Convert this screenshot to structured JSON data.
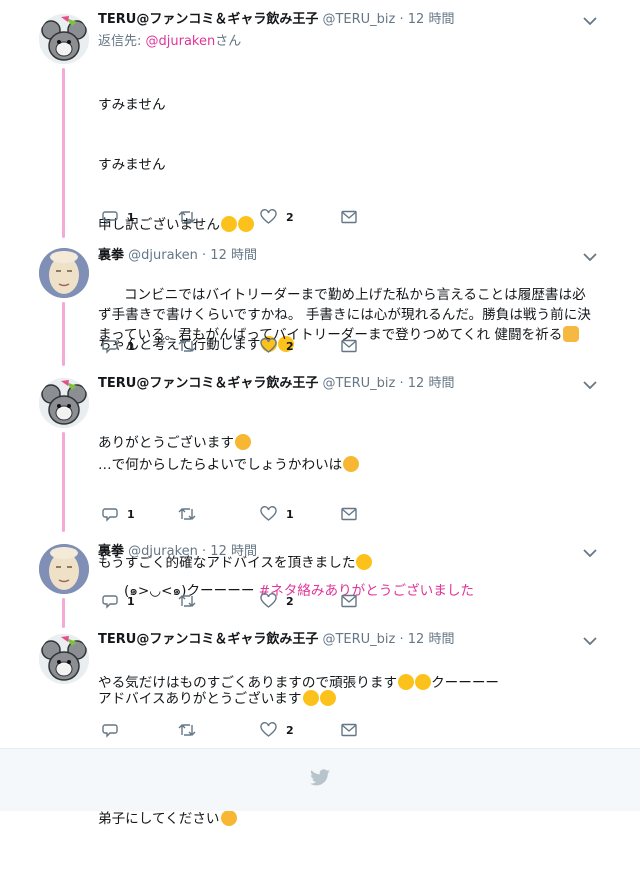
{
  "tweets": [
    {
      "name": "TERU@ファンコミ＆ギャラ飲み王子",
      "handle": "@TERU_biz",
      "dot": "·",
      "time": "12 時間",
      "reply_prefix": "返信先: ",
      "reply_mention": "@djuraken",
      "reply_suffix": "さん",
      "lines": [
        "すみません",
        "すみません",
        "申し訳ございません",
        "",
        "ちゃんと考えて行動します",
        "",
        "…で何からしたらよいでしょうかわいは"
      ],
      "reply_count": "1",
      "retweet_count": "",
      "like_count": "2"
    },
    {
      "name": "裏拳",
      "handle": "@djuraken",
      "dot": "·",
      "time": "12 時間",
      "text": "コンビニではバイトリーダーまで勤め上げた私から言えることは履歴書は必ず手書きで書けくらいですかね。 手書きには心が現れるんだ。勝負は戦う前に決まっている。君もがんばってバイトリーダーまで登りつめてくれ 健闘を祈る",
      "reply_count": "1",
      "retweet_count": "",
      "like_count": "2"
    },
    {
      "name": "TERU@ファンコミ＆ギャラ飲み王子",
      "handle": "@TERU_biz",
      "dot": "·",
      "time": "12 時間",
      "lines": [
        "ありがとうございます",
        "",
        "もうすごく的確なアドバイスを頂きました",
        "",
        "やる気だけはものすごくありますので頑張ります"
      ],
      "line5_tail": "クーーーー",
      "reply_count": "1",
      "retweet_count": "",
      "like_count": "1"
    },
    {
      "name": "裏拳",
      "handle": "@djuraken",
      "dot": "·",
      "time": "12 時間",
      "text_plain": "(๑>◡<๑)クーーーー ",
      "hashtag": "#ネタ絡みありがとうございました",
      "reply_count": "1",
      "retweet_count": "",
      "like_count": "2"
    },
    {
      "name": "TERU@ファンコミ＆ギャラ飲み王子",
      "handle": "@TERU_biz",
      "dot": "·",
      "time": "12 時間",
      "lines": [
        "アドバイスありがとうございます",
        "",
        "弟子にしてください"
      ],
      "reply_count": "",
      "retweet_count": "",
      "like_count": "2"
    }
  ],
  "icons": {
    "reply": "reply-icon",
    "retweet": "retweet-icon",
    "like": "heart-icon",
    "dm": "envelope-icon",
    "more": "chevron-down-icon",
    "footer": "twitter-bird-icon"
  },
  "colors": {
    "accent": "#e0359a",
    "thread_line": "#f4a9d6",
    "secondary_text": "#657786",
    "footer_bg": "#f5f8fa"
  }
}
